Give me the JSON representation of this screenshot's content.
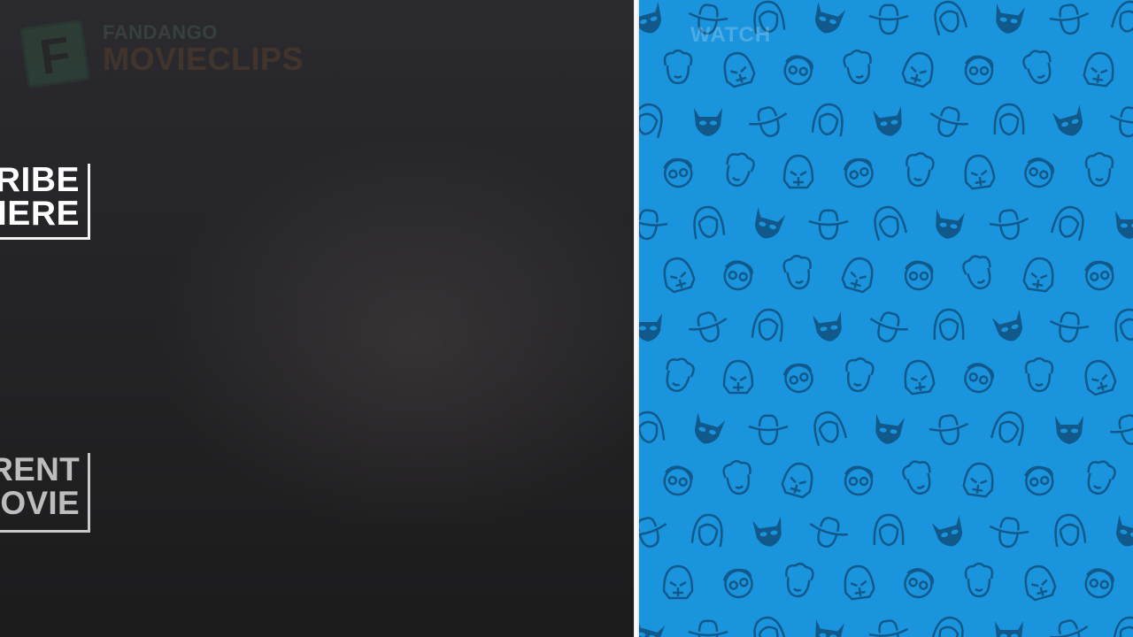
{
  "logo": {
    "brand_top": "FANDANGO",
    "brand_bottom": "MOVIECLIPS",
    "mark_letter": "F"
  },
  "subscribe": {
    "line1": "SUBSCRIBE",
    "line2": "HERE"
  },
  "buy": {
    "line1": "BUY OR RENT",
    "line2": "THE FULL MOVIE"
  },
  "right_panel": {
    "label": "WATCH",
    "background_color": "#1a94dd",
    "pattern_icons": [
      "batman-mask-icon",
      "darth-vader-icon",
      "cowboy-hat-icon",
      "glasses-face-icon",
      "woman-face-icon",
      "curly-hair-face-icon"
    ]
  }
}
